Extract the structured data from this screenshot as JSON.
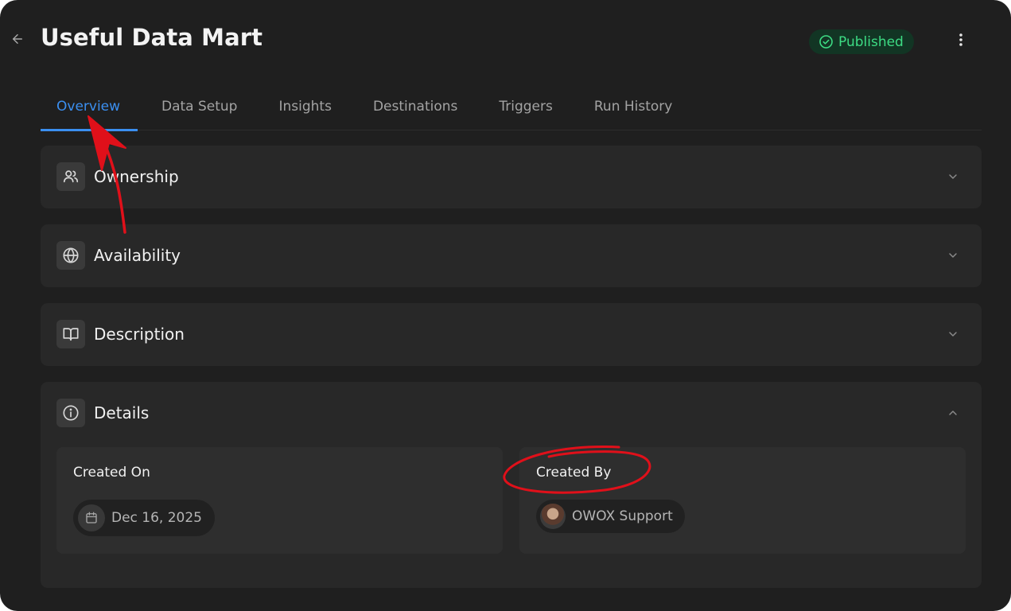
{
  "header": {
    "title": "Useful Data Mart",
    "status": "Published",
    "colors": {
      "accent": "#3b8ff0",
      "status_text": "#3ddc84",
      "status_bg": "#123524",
      "annotation": "#e0101a"
    }
  },
  "tabs": [
    {
      "label": "Overview",
      "active": true
    },
    {
      "label": "Data Setup"
    },
    {
      "label": "Insights"
    },
    {
      "label": "Destinations"
    },
    {
      "label": "Triggers"
    },
    {
      "label": "Run History"
    }
  ],
  "sections": {
    "ownership": {
      "title": "Ownership",
      "icon": "users-icon",
      "expanded": false
    },
    "availability": {
      "title": "Availability",
      "icon": "globe-icon",
      "expanded": false
    },
    "description": {
      "title": "Description",
      "icon": "book-icon",
      "expanded": false
    },
    "details": {
      "title": "Details",
      "icon": "info-icon",
      "expanded": true,
      "created_on_label": "Created On",
      "created_on_value": "Dec 16, 2025",
      "created_by_label": "Created By",
      "created_by_value": "OWOX Support"
    }
  }
}
